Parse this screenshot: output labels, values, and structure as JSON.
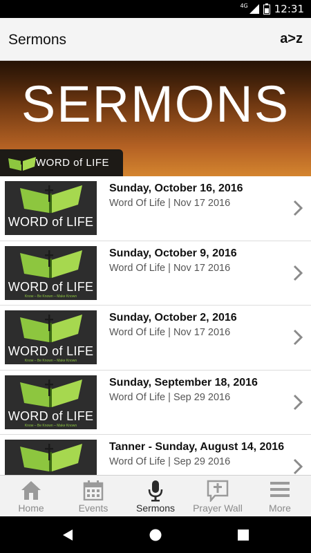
{
  "status_bar": {
    "time": "12:31",
    "network": "4G"
  },
  "app_bar": {
    "title": "Sermons",
    "sort_label": "a>z"
  },
  "banner": {
    "title": "SERMONS",
    "tag": "WORD of LIFE"
  },
  "thumbnail": {
    "logo_text": "WORD of LIFE",
    "tagline": "Know – Be Known – Make Known"
  },
  "sermons": [
    {
      "title": "Sunday, October 16, 2016",
      "subtitle": "Word Of Life | Nov 17 2016"
    },
    {
      "title": "Sunday, October 9, 2016",
      "subtitle": "Word Of Life | Nov 17 2016"
    },
    {
      "title": "Sunday, October 2, 2016",
      "subtitle": "Word Of Life | Nov 17 2016"
    },
    {
      "title": "Sunday, September 18, 2016",
      "subtitle": "Word Of Life | Sep 29 2016"
    },
    {
      "title": "Tanner - Sunday, August 14, 2016",
      "subtitle": "Word Of Life | Sep 29 2016"
    }
  ],
  "tabs": [
    {
      "label": "Home",
      "icon": "home-icon"
    },
    {
      "label": "Events",
      "icon": "calendar-icon"
    },
    {
      "label": "Sermons",
      "icon": "microphone-icon",
      "active": true
    },
    {
      "label": "Prayer Wall",
      "icon": "prayer-icon"
    },
    {
      "label": "More",
      "icon": "menu-icon"
    }
  ],
  "colors": {
    "accent_green": "#8dc63f",
    "banner_orange": "#b56224",
    "active_tab": "#2a2a2a",
    "inactive_tab": "#8a8a8a"
  }
}
